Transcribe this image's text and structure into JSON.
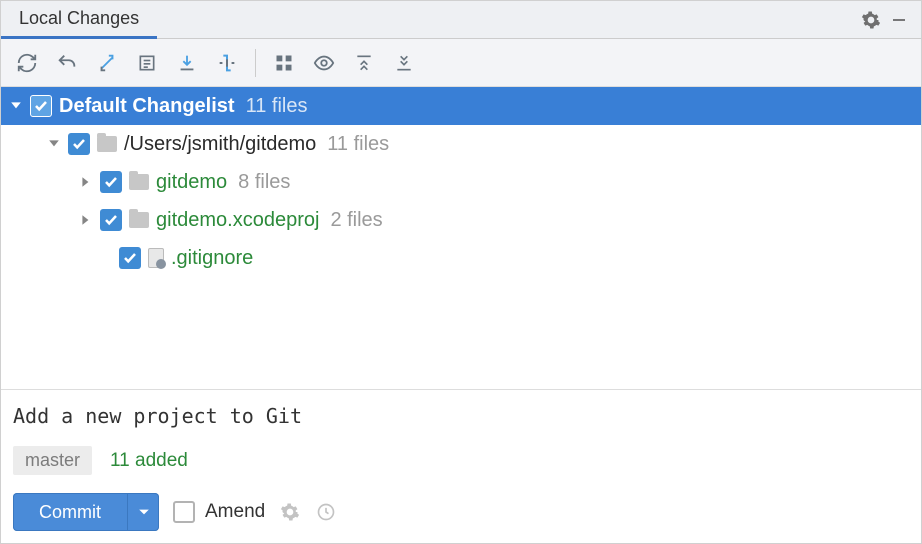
{
  "tab": {
    "title": "Local Changes"
  },
  "tree": {
    "root": {
      "label": "Default Changelist",
      "count": "11 files"
    },
    "path": {
      "label": "/Users/jsmith/gitdemo",
      "count": "11 files"
    },
    "sub1": {
      "label": "gitdemo",
      "count": "8 files"
    },
    "sub2": {
      "label": "gitdemo.xcodeproj",
      "count": "2 files"
    },
    "file1": {
      "label": ".gitignore"
    }
  },
  "commit": {
    "message": "Add a new project to Git",
    "branch": "master",
    "added": "11 added",
    "button": "Commit",
    "amend": "Amend"
  }
}
